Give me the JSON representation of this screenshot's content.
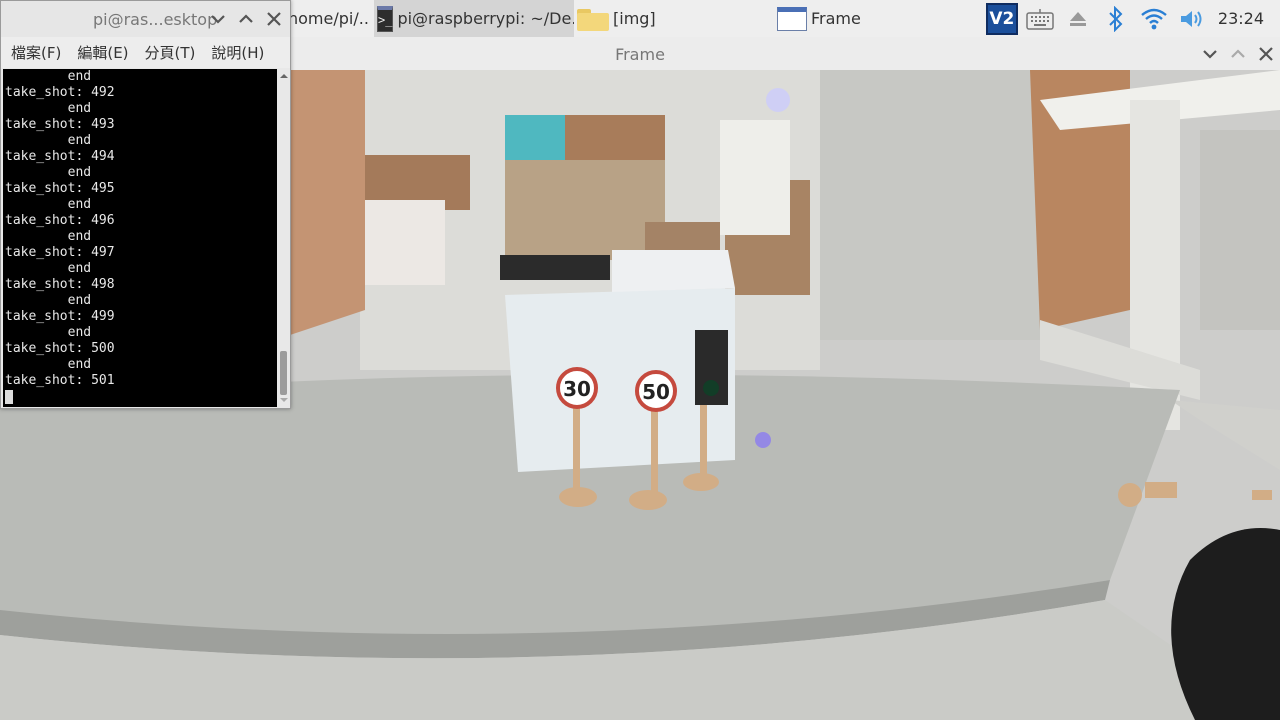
{
  "taskbar": {
    "tasks": [
      {
        "label": "home/pi/..."
      },
      {
        "label": "pi@raspberrypi: ~/De..."
      },
      {
        "label": "[img]"
      },
      {
        "label": "Frame"
      }
    ],
    "vnc_label": "V2",
    "clock": "23:24",
    "icons": [
      "vnc-icon",
      "keyboard-icon",
      "eject-icon",
      "bluetooth-icon",
      "wifi-icon",
      "volume-icon"
    ]
  },
  "frame_window": {
    "title": "Frame",
    "signs": [
      "30",
      "50"
    ]
  },
  "terminal": {
    "title": "pi@ras...esktop",
    "menu": [
      "檔案(F)",
      "編輯(E)",
      "分頁(T)",
      "說明(H)"
    ],
    "lines": [
      "        end",
      "take_shot: 492",
      "        end",
      "take_shot: 493",
      "        end",
      "take_shot: 494",
      "        end",
      "take_shot: 495",
      "        end",
      "take_shot: 496",
      "        end",
      "take_shot: 497",
      "        end",
      "take_shot: 498",
      "        end",
      "take_shot: 499",
      "        end",
      "take_shot: 500",
      "        end",
      "take_shot: 501"
    ]
  }
}
